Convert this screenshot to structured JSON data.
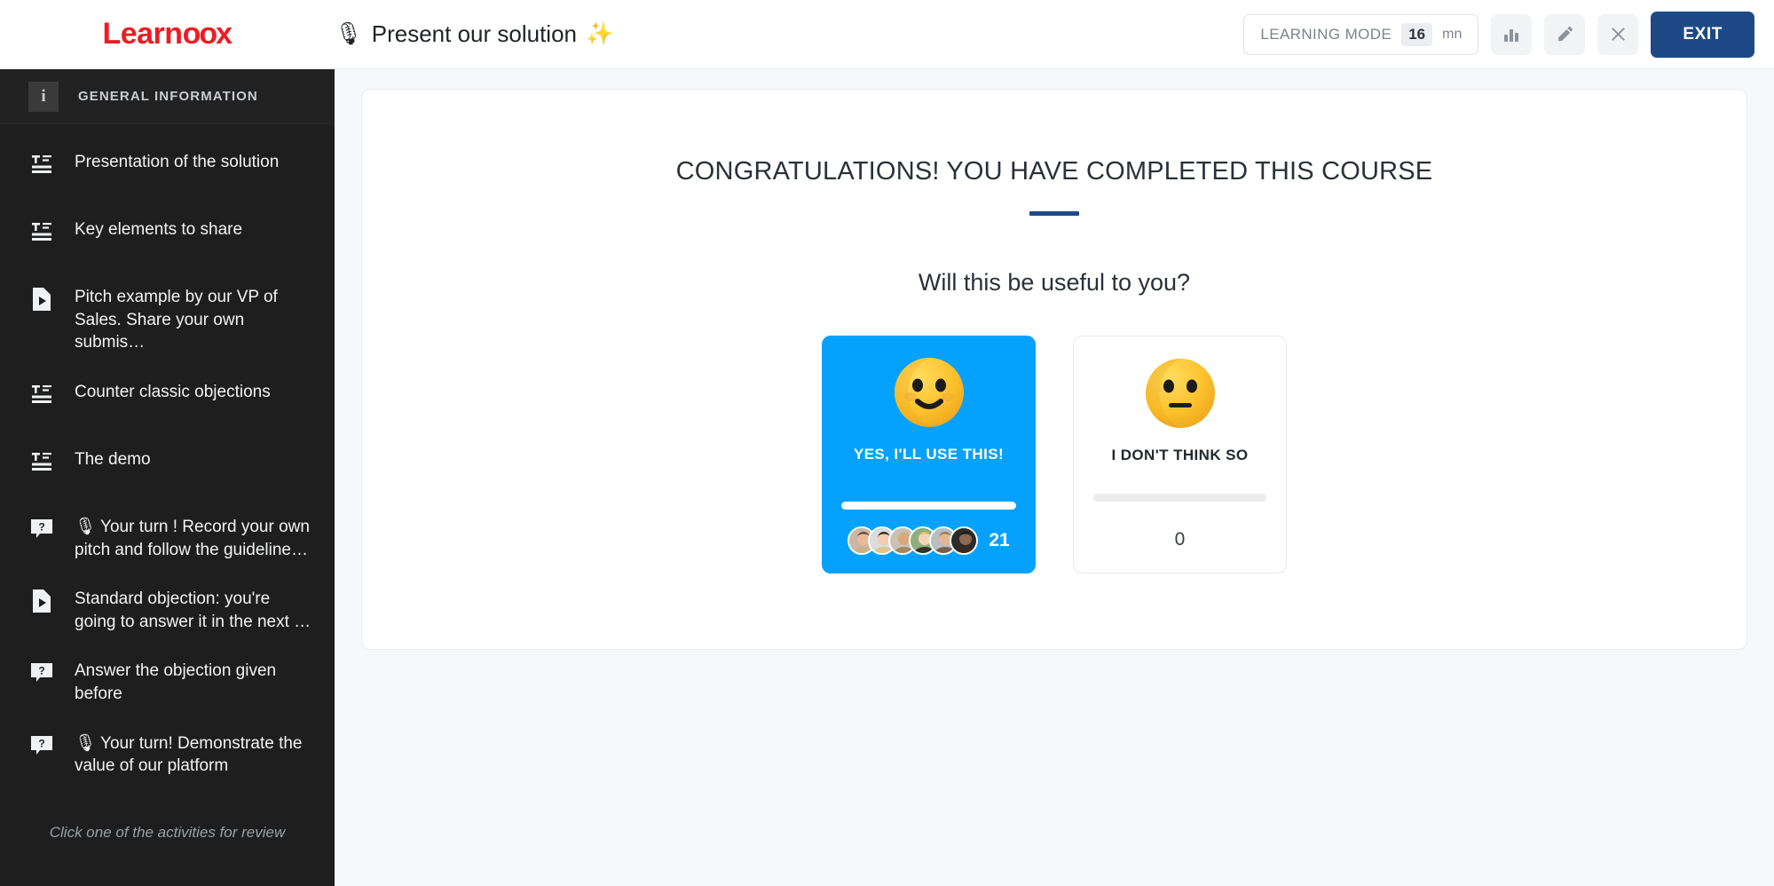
{
  "topbar": {
    "logo_text_a": "Learn",
    "logo_text_oo": "oo",
    "logo_text_b": "x",
    "doc_emoji": "🎙",
    "doc_title": "Present our solution",
    "doc_sparkle": "✨",
    "mode_label": "LEARNING MODE",
    "mode_value": "16",
    "mode_unit": "mn",
    "stats_icon": "bar-chart-icon",
    "edit_icon": "pencil-icon",
    "close_icon": "close-icon",
    "exit_label": "EXIT",
    "accent_color": "#1d4a86"
  },
  "sidebar": {
    "header_icon": "info-icon",
    "header_icon_glyph": "i",
    "header_label": "GENERAL INFORMATION",
    "footer_hint": "Click one of the activities for review",
    "items": [
      {
        "label": "Presentation of the solution",
        "icon": "text-block-icon"
      },
      {
        "label": "Key elements to share",
        "icon": "text-block-icon"
      },
      {
        "label": "Pitch example by our VP of Sales. Share your own submis…",
        "icon": "video-file-icon"
      },
      {
        "label": "Counter classic objections",
        "icon": "text-block-icon"
      },
      {
        "label": "The demo",
        "icon": "text-block-icon"
      },
      {
        "label": "🎙 Your turn ! Record your own pitch and follow the guideline…",
        "icon": "question-bubble-icon"
      },
      {
        "label": "Standard objection: you're going to answer it in the next …",
        "icon": "video-file-icon"
      },
      {
        "label": "Answer the objection given before",
        "icon": "question-bubble-icon"
      },
      {
        "label": "🎙 Your turn! Demonstrate the value of our platform",
        "icon": "question-bubble-icon"
      }
    ]
  },
  "main": {
    "completion_title": "CONGRATULATIONS! YOU HAVE COMPLETED THIS COURSE",
    "question": "Will this be useful to you?",
    "options": [
      {
        "label": "YES, I'LL USE THIS!",
        "emoji": "slightly-smiling-face",
        "count": "21",
        "selected": true,
        "bar_fill_percent": 100,
        "avatar_count": 6,
        "color": "#06a1fc"
      },
      {
        "label": "I DON'T THINK SO",
        "emoji": "neutral-face",
        "count": "0",
        "selected": false,
        "bar_fill_percent": 0,
        "avatar_count": 0,
        "color": "#ffffff"
      }
    ]
  }
}
